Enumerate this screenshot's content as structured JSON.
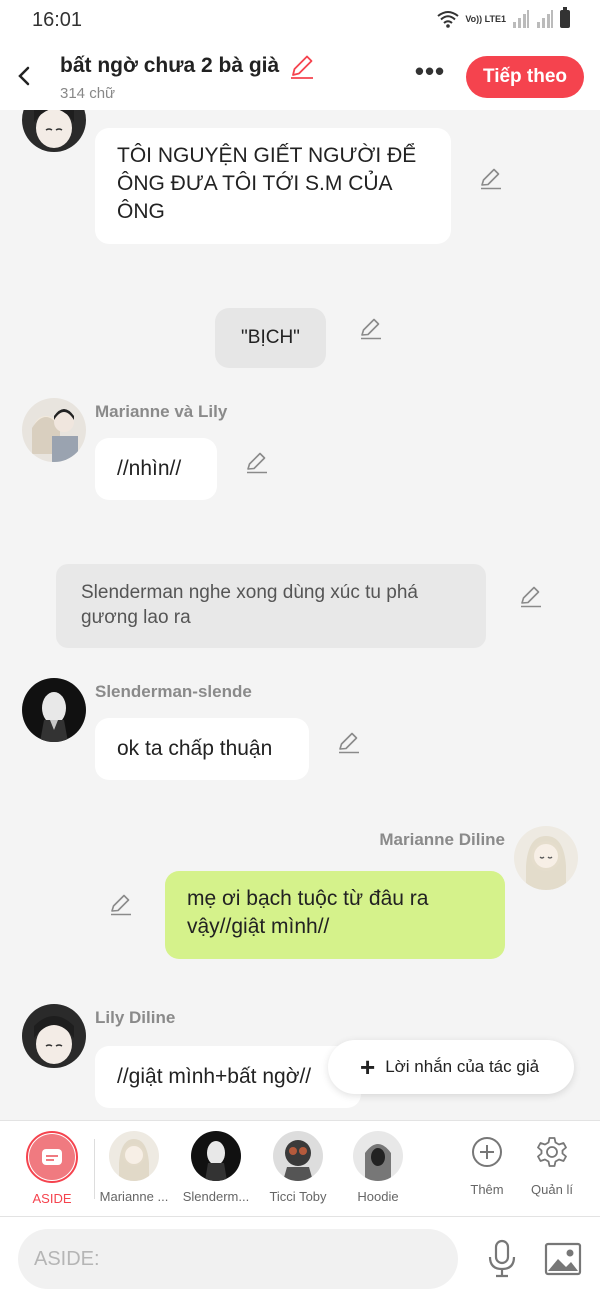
{
  "status_bar": {
    "time": "16:01",
    "network": "Vo)) LTE1"
  },
  "header": {
    "title": "bất ngờ chưa 2 bà già",
    "word_count": "314 chữ",
    "next_label": "Tiếp theo"
  },
  "messages": [
    {
      "type": "left",
      "sender": "",
      "text": "TÔI NGUYỆN GIẾT NGƯỜI ĐỂ ÔNG ĐƯA TÔI TỚI S.M CỦA ÔNG"
    },
    {
      "type": "center",
      "text": "\"BỊCH\""
    },
    {
      "type": "left",
      "sender": "Marianne và Lily",
      "text": "//nhìn//"
    },
    {
      "type": "narration",
      "text": "Slenderman nghe xong dùng xúc tu phá gương lao ra"
    },
    {
      "type": "left",
      "sender": "Slenderman-slende",
      "text": "ok ta chấp thuận"
    },
    {
      "type": "right",
      "sender": "Marianne Diline",
      "text": "mẹ ơi bạch tuộc từ đâu ra vậy//giật mình//"
    },
    {
      "type": "left",
      "sender": "Lily Diline",
      "text": "//giật mình+bất ngờ//"
    }
  ],
  "fab": {
    "label": "Lời nhắn của tác giả"
  },
  "characters": [
    {
      "name": "ASIDE"
    },
    {
      "name": "Marianne ..."
    },
    {
      "name": "Slenderm..."
    },
    {
      "name": "Ticci Toby"
    },
    {
      "name": "Hoodie"
    }
  ],
  "tools": {
    "add_label": "Thêm",
    "manage_label": "Quản lí"
  },
  "input": {
    "placeholder": "ASIDE:"
  },
  "colors": {
    "accent": "#f5434e",
    "right_bubble": "#d5f28b",
    "background": "#f4f4f4"
  }
}
